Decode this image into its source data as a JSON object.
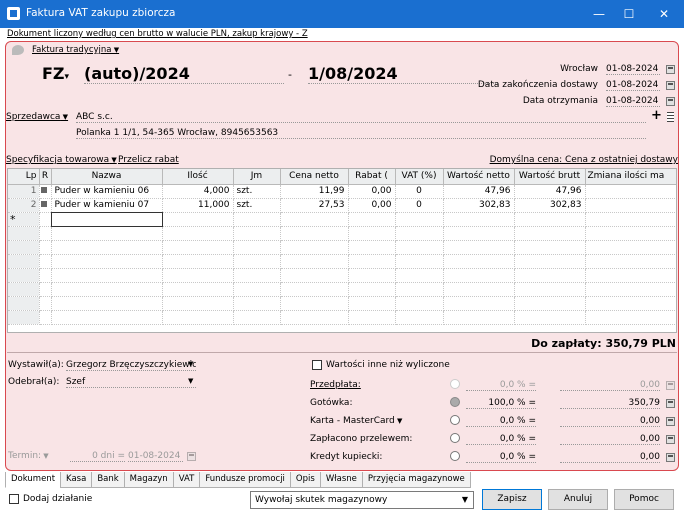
{
  "window": {
    "title": "Faktura VAT zakupu zbiorcza",
    "minimize": "—",
    "maximize": "☐",
    "close": "✕"
  },
  "topnote": "Dokument liczony według cen brutto w walucie PLN, zakup krajowy - Z",
  "doc_type_link": "Faktura tradycyjna",
  "series": "FZ",
  "doc_number": "(auto)/2024",
  "dash": "-",
  "doc_date": "1/08/2024",
  "right_dates": [
    {
      "label": "Wrocław",
      "value": "01-08-2024"
    },
    {
      "label": "Data zakończenia dostawy",
      "value": "01-08-2024"
    },
    {
      "label": "Data otrzymania",
      "value": "01-08-2024"
    }
  ],
  "seller": {
    "label": "Sprzedawca",
    "name": "ABC s.c.",
    "address": "Polanka 1 1/1, 54-365 Wrocław, 8945653563",
    "plus": "+"
  },
  "spec": {
    "label": "Specyfikacja towarowa",
    "recalc": "Przelicz rabat",
    "default_price": "Domyślna cena: Cena z ostatniej dostawy"
  },
  "grid": {
    "columns": [
      "Lp",
      "R",
      "Nazwa",
      "Ilość",
      "Jm",
      "Cena netto",
      "Rabat (",
      "VAT (%)",
      "Wartość netto",
      "Wartość brutt",
      "Zmiana ilości ma"
    ],
    "rows": [
      {
        "lp": "1",
        "name": "Puder w kamieniu 06",
        "qty": "4,000",
        "unit": "szt.",
        "price": "11,99",
        "disc": "0,00",
        "vat": "0",
        "net": "47,96",
        "gross": "47,96",
        "change": ""
      },
      {
        "lp": "2",
        "name": "Puder w kamieniu 07",
        "qty": "11,000",
        "unit": "szt.",
        "price": "27,53",
        "disc": "0,00",
        "vat": "0",
        "net": "302,83",
        "gross": "302,83",
        "change": ""
      }
    ],
    "new_row_marker": "*"
  },
  "total": "Do zapłaty: 350,79 PLN",
  "issued": {
    "label": "Wystawił(a):",
    "value": "Grzegorz Brzęczyszczykiewicz"
  },
  "received": {
    "label": "Odebrał(a):",
    "value": "Szef"
  },
  "term": {
    "label": "Termin:",
    "days": "0 dni =",
    "date": "01-08-2024"
  },
  "other_values": "Wartości inne niż wyliczone",
  "payments": [
    {
      "label": "Przedpłata:",
      "pct": "0,0 % =",
      "amount": "0,00",
      "underline": true,
      "state": "dis"
    },
    {
      "label": "Gotówka:",
      "pct": "100,0 % =",
      "amount": "350,79",
      "underline": false,
      "state": "on"
    },
    {
      "label": "Karta - MasterCard",
      "pct": "0,0 % =",
      "amount": "0,00",
      "underline": false,
      "state": "off"
    },
    {
      "label": "Zapłacono przelewem:",
      "pct": "0,0 % =",
      "amount": "0,00",
      "underline": false,
      "state": "off"
    },
    {
      "label": "Kredyt kupiecki:",
      "pct": "0,0 % =",
      "amount": "0,00",
      "underline": false,
      "state": "off"
    }
  ],
  "tabs": [
    "Dokument",
    "Kasa",
    "Bank",
    "Magazyn",
    "VAT",
    "Fundusze promocji",
    "Opis",
    "Własne",
    "Przyjęcia magazynowe"
  ],
  "footer": {
    "add_action": "Dodaj działanie",
    "warehouse_effect": "Wywołaj skutek magazynowy",
    "save": "Zapisz",
    "cancel": "Anuluj",
    "help": "Pomoc"
  }
}
